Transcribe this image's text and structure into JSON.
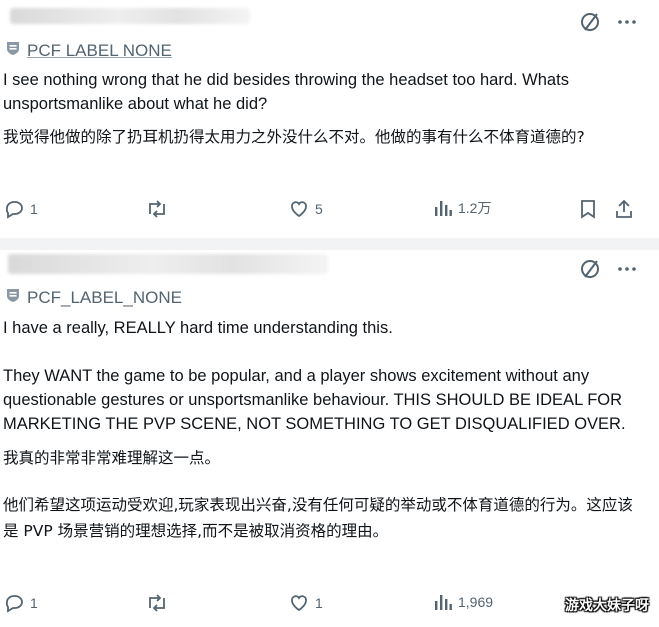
{
  "posts": [
    {
      "label": "PCF LABEL NONE",
      "text_en": "I see nothing wrong that he did besides throwing the headset too hard. Whats unsportsmanlike about what he did?",
      "text_zh": "我觉得他做的除了扔耳机扔得太用力之外没什么不对。他做的事有什么不体育道德的?",
      "replies": "1",
      "likes": "5",
      "views": "1.2万"
    },
    {
      "label": "PCF_LABEL_NONE",
      "text_en_1": "I have a really, REALLY hard time understanding this.",
      "text_en_2": "They WANT the game to be popular, and a player shows excitement without any questionable gestures or unsportsmanlike behaviour. THIS SHOULD BE IDEAL FOR MARKETING THE PVP SCENE, NOT SOMETHING TO GET DISQUALIFIED OVER.",
      "text_zh_1": "我真的非常非常难理解这一点。",
      "text_zh_2": "他们希望这项运动受欢迎,玩家表现出兴奋,没有任何可疑的举动或不体育道德的行为。这应该是 PVP 场景营销的理想选择,而不是被取消资格的理由。",
      "replies": "1",
      "likes": "1",
      "views": "1,969"
    }
  ],
  "watermark": "游戏大妹子呀",
  "colors": {
    "text": "#0f1419",
    "muted": "#536471",
    "background": "#ffffff",
    "divider": "#f1f3f5"
  },
  "icons": [
    "grok-slash-icon",
    "more-icon",
    "label-icon",
    "reply-icon",
    "repost-icon",
    "like-icon",
    "views-icon",
    "bookmark-icon",
    "share-icon"
  ]
}
